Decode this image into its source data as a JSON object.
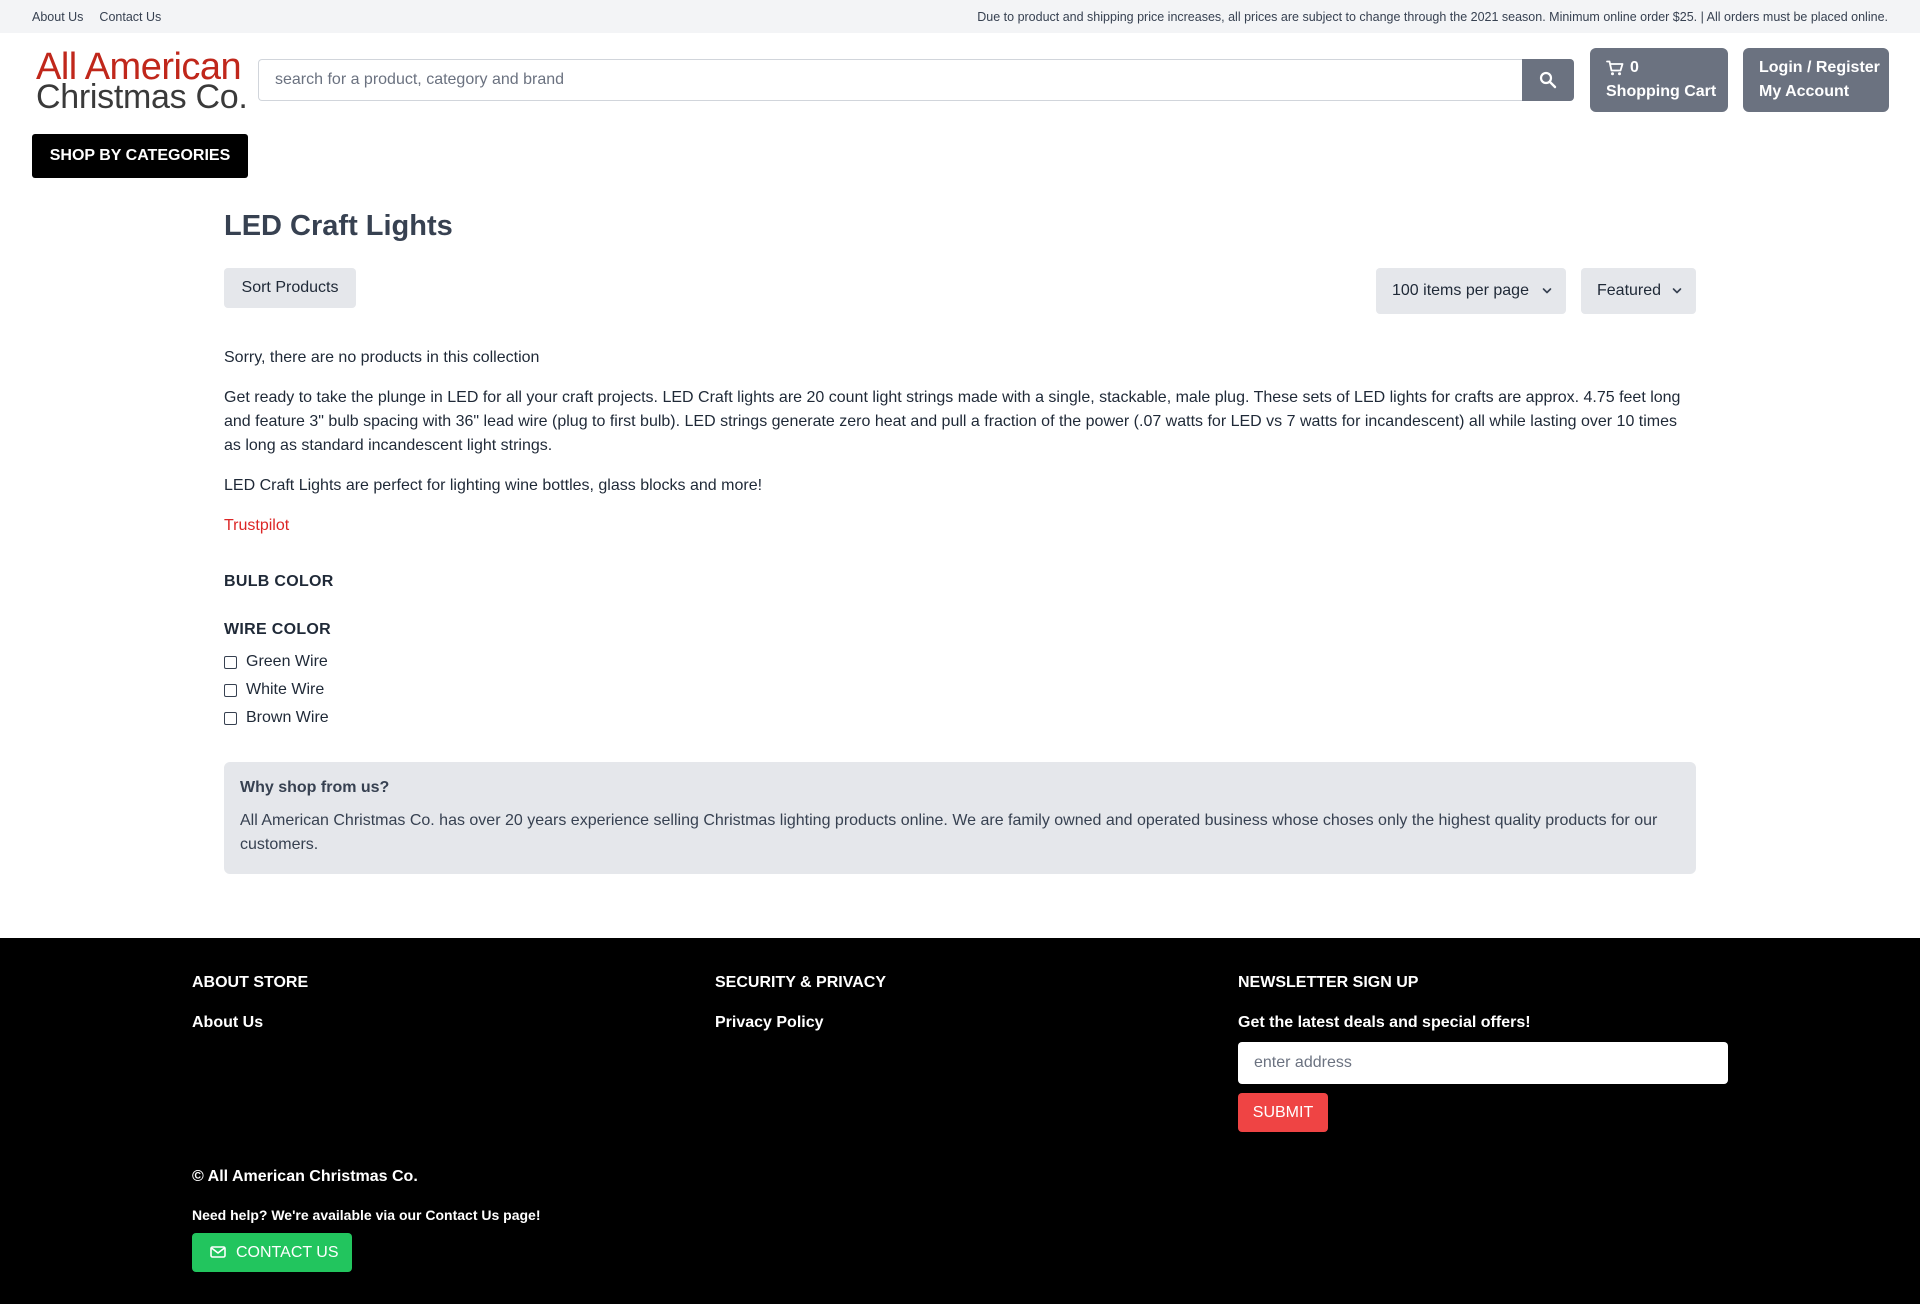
{
  "topbar": {
    "links": [
      "About Us",
      "Contact Us"
    ],
    "notice": "Due to product and shipping price increases, all prices are subject to change through the 2021 season. Minimum online order $25. | All orders must be placed online."
  },
  "header": {
    "logo_line1": "All American",
    "logo_line2": "Christmas Co.",
    "search_placeholder": "search for a product, category and brand",
    "cart_count": "0",
    "cart_label": "Shopping Cart",
    "login_label": "Login / Register",
    "account_label": "My Account",
    "shop_categories": "SHOP BY CATEGORIES"
  },
  "main": {
    "title": "LED Craft Lights",
    "sort_button": "Sort Products",
    "per_page": "100 items per page",
    "sort_value": "Featured",
    "empty_message": "Sorry, there are no products in this collection",
    "description": "Get ready to take the plunge in LED for all your craft projects. LED Craft lights are 20 count light strings made with a single, stackable, male plug. These sets of LED lights for crafts are approx. 4.75 feet long and feature 3\" bulb spacing with 36\" lead wire (plug to first bulb). LED strings generate zero heat and pull a fraction of the power (.07 watts for LED vs 7 watts for incandescent) all while lasting over 10 times as long as standard incandescent light strings.",
    "perfect_for": "LED Craft Lights are perfect for lighting wine bottles, glass blocks and more!",
    "trustpilot": "Trustpilot",
    "filters": {
      "bulb_color": "BULB COLOR",
      "wire_color": "WIRE COLOR",
      "wire_options": [
        "Green Wire",
        "White Wire",
        "Brown Wire"
      ]
    },
    "why": {
      "heading": "Why shop from us?",
      "text": "All American Christmas Co. has over 20 years experience selling Christmas lighting products online. We are family owned and operated business whose choses only the highest quality products for our customers."
    }
  },
  "footer": {
    "about_heading": "ABOUT STORE",
    "about_link": "About Us",
    "security_heading": "SECURITY & PRIVACY",
    "privacy_link": "Privacy Policy",
    "newsletter_heading": "NEWSLETTER SIGN UP",
    "newsletter_text": "Get the latest deals and special offers!",
    "email_placeholder": "enter address",
    "submit": "SUBMIT",
    "copyright": "© All American Christmas Co.",
    "help": "Need help? We're available via our Contact Us page!",
    "contact_button": "CONTACT US"
  },
  "colors": {
    "brand_red": "#c0271b",
    "button_gray": "#6b7280",
    "submit_red": "#ef4444",
    "contact_green": "#22c55e",
    "link_red": "#dc2626"
  },
  "icons": [
    "search-icon",
    "cart-icon",
    "chevron-down-icon",
    "envelope-icon"
  ]
}
